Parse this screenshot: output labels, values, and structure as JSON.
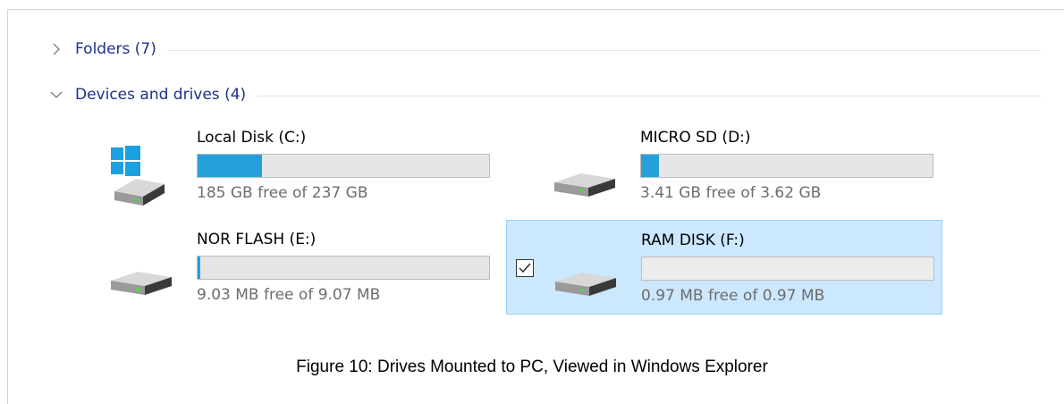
{
  "groups": {
    "folders": {
      "title": "Folders (7)",
      "expanded": false
    },
    "devices": {
      "title": "Devices and drives (4)",
      "expanded": true
    }
  },
  "drives": [
    {
      "name": "Local Disk (C:)",
      "free_text": "185 GB free of 237 GB",
      "used_fraction": 0.22,
      "icon": "windows-system-drive-icon",
      "selected": false
    },
    {
      "name": "MICRO SD (D:)",
      "free_text": "3.41 GB free of 3.62 GB",
      "used_fraction": 0.06,
      "icon": "drive-icon",
      "selected": false
    },
    {
      "name": "NOR FLASH (E:)",
      "free_text": "9.03 MB free of 9.07 MB",
      "used_fraction": 0.01,
      "icon": "drive-icon",
      "selected": false
    },
    {
      "name": "RAM DISK (F:)",
      "free_text": "0.97 MB free of 0.97 MB",
      "used_fraction": 0.0,
      "icon": "drive-icon",
      "selected": true
    }
  ],
  "caption": "Figure 10: Drives Mounted to PC, Viewed in Windows Explorer",
  "colors": {
    "accent": "#26a0da",
    "group_title": "#1e3287",
    "selection_bg": "#cce8ff",
    "selection_border": "#99d1ff"
  }
}
